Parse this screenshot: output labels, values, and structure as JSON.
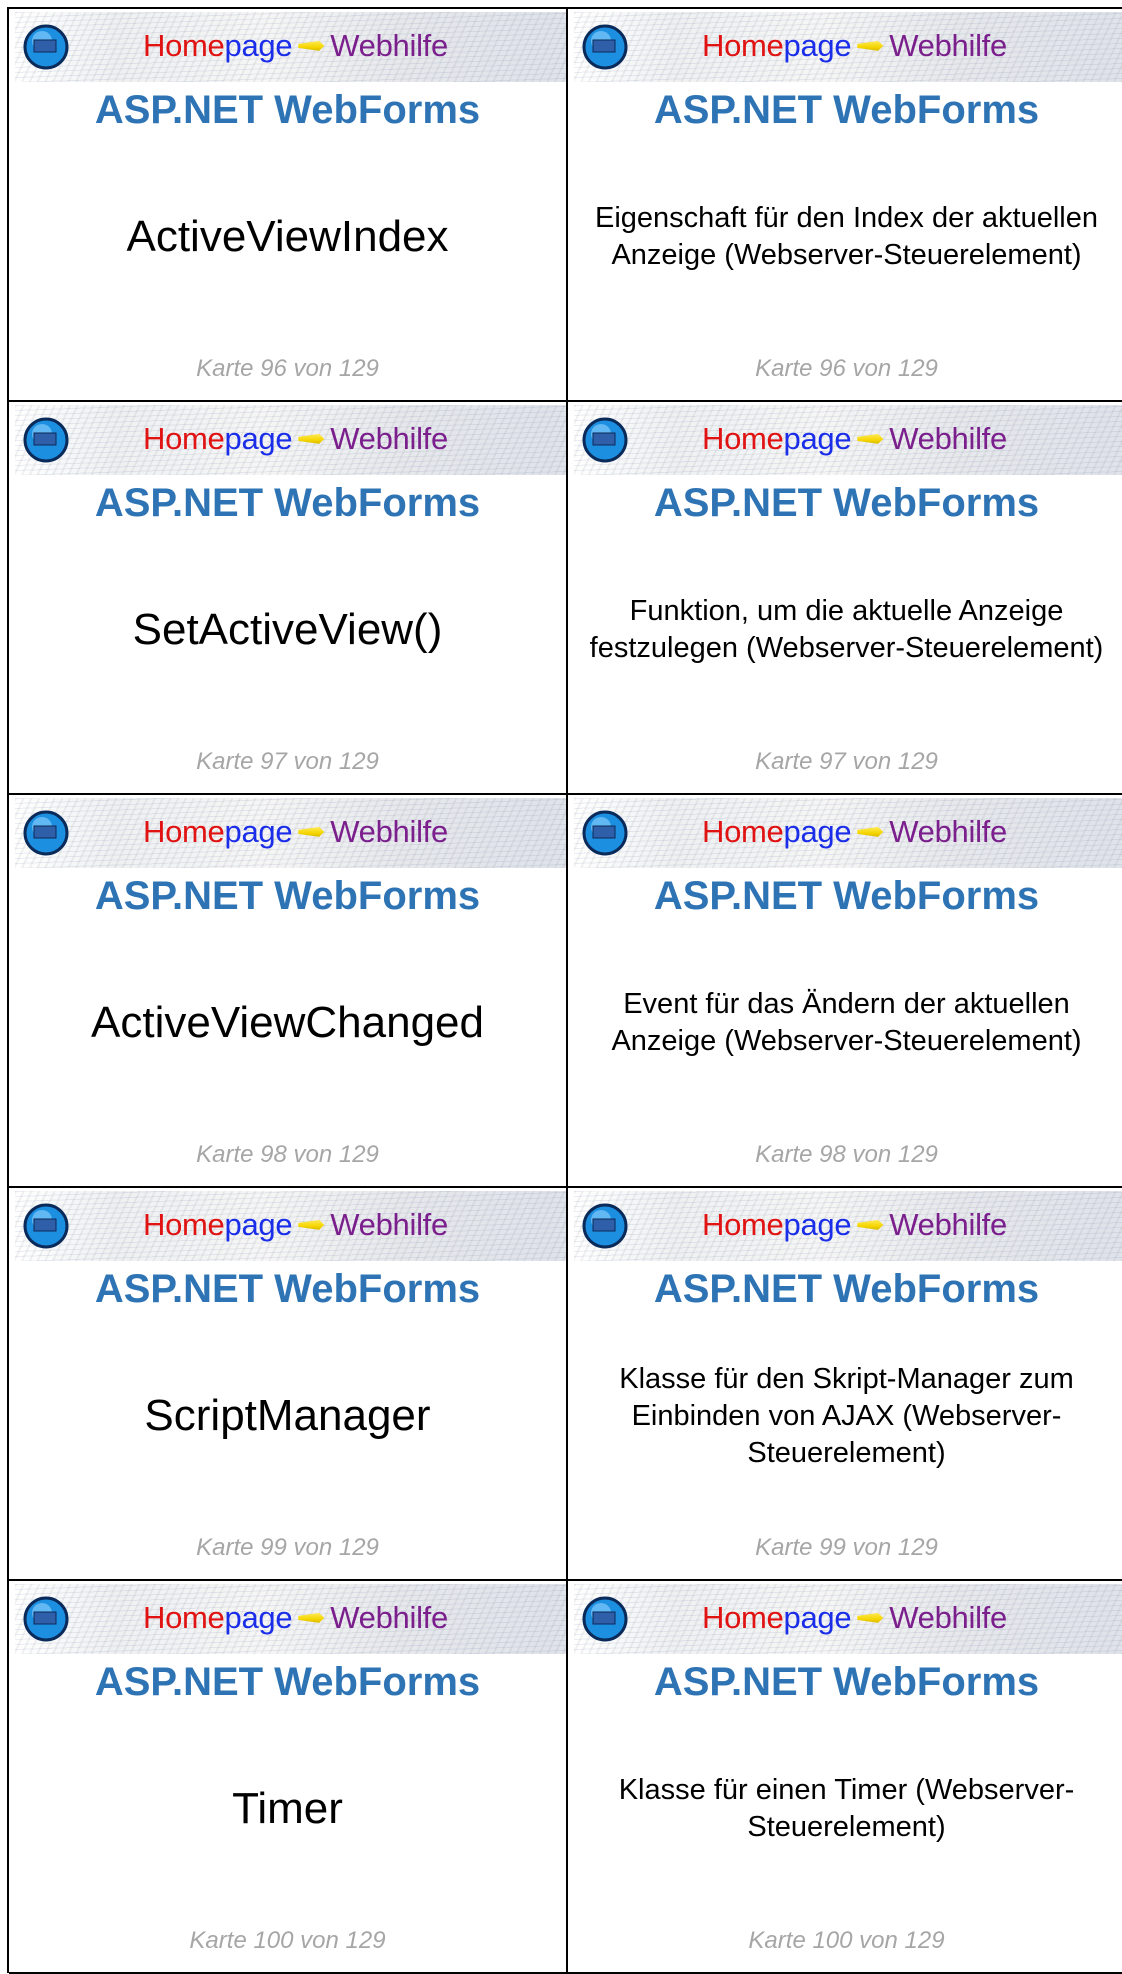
{
  "banner": {
    "logo_icon": "homepage-webhilfe-logo-icon",
    "home_a": "Home",
    "home_b": "page",
    "web": "Webhilfe"
  },
  "colors": {
    "heading": "#2e74b5",
    "footer": "#a6a6a6",
    "home_red": "#e01212",
    "home_blue": "#1a2de8",
    "web_purple": "#7a1f8c"
  },
  "cards": [
    {
      "heading": "ASP.NET WebForms",
      "front": "ActiveViewIndex",
      "back": "Eigenschaft für den Index der aktuellen Anzeige (Webserver-Steuerelement)",
      "footer": "Karte 96 von 129"
    },
    {
      "heading": "ASP.NET WebForms",
      "front": "SetActiveView()",
      "back": "Funktion, um die aktuelle Anzeige festzulegen (Webserver-Steuerelement)",
      "footer": "Karte 97 von 129"
    },
    {
      "heading": "ASP.NET WebForms",
      "front": "ActiveViewChanged",
      "back": "Event für das Ändern der aktuellen Anzeige (Webserver-Steuerelement)",
      "footer": "Karte 98 von 129"
    },
    {
      "heading": "ASP.NET WebForms",
      "front": "ScriptManager",
      "back": "Klasse für den Skript-Manager zum Einbinden von AJAX (Webserver-Steuerelement)",
      "footer": "Karte 99 von 129"
    },
    {
      "heading": "ASP.NET WebForms",
      "front": "Timer",
      "back": "Klasse für einen Timer (Webserver-Steuerelement)",
      "footer": "Karte 100 von 129"
    }
  ]
}
